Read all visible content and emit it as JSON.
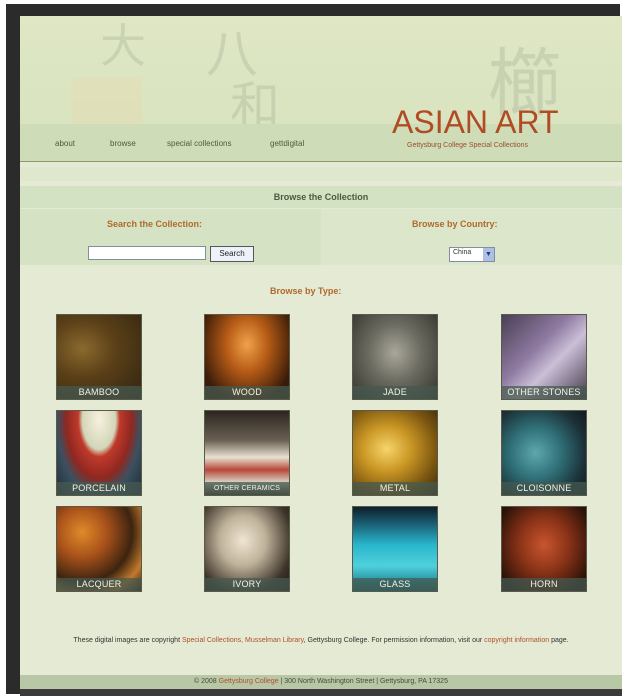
{
  "header": {
    "brand_title": "ASIAN ART",
    "brand_subtitle": "Gettysburg College Special Collections",
    "nav": [
      "about",
      "browse",
      "special collections",
      "gettdigital"
    ]
  },
  "browse_bar": "Browse the Collection",
  "search": {
    "heading": "Search the Collection:",
    "input_value": "",
    "button_label": "Search"
  },
  "country": {
    "heading": "Browse by Country:",
    "selected": "China"
  },
  "types": {
    "heading": "Browse by Type:",
    "items": [
      "BAMBOO",
      "WOOD",
      "JADE",
      "OTHER STONES",
      "PORCELAIN",
      "OTHER CERAMICS",
      "METAL",
      "CLOISONNE",
      "LACQUER",
      "IVORY",
      "GLASS",
      "HORN"
    ]
  },
  "footer": {
    "text_before": "These digital images are copyright ",
    "link_special": "Special Collections, Musselman Library",
    "text_mid": ", Gettysburg College. For permission information, visit our ",
    "link_copyright": "copyright information",
    "text_after": " page.",
    "bottom_prefix": "© 2008 ",
    "bottom_link": "Gettysburg College",
    "bottom_rest": " | 300 North Washington Street | Gettysburg, PA 17325"
  },
  "colors": {
    "brand": "#b04c24",
    "section_heading": "#b06a2c",
    "page_bg": "#e4ead3"
  }
}
